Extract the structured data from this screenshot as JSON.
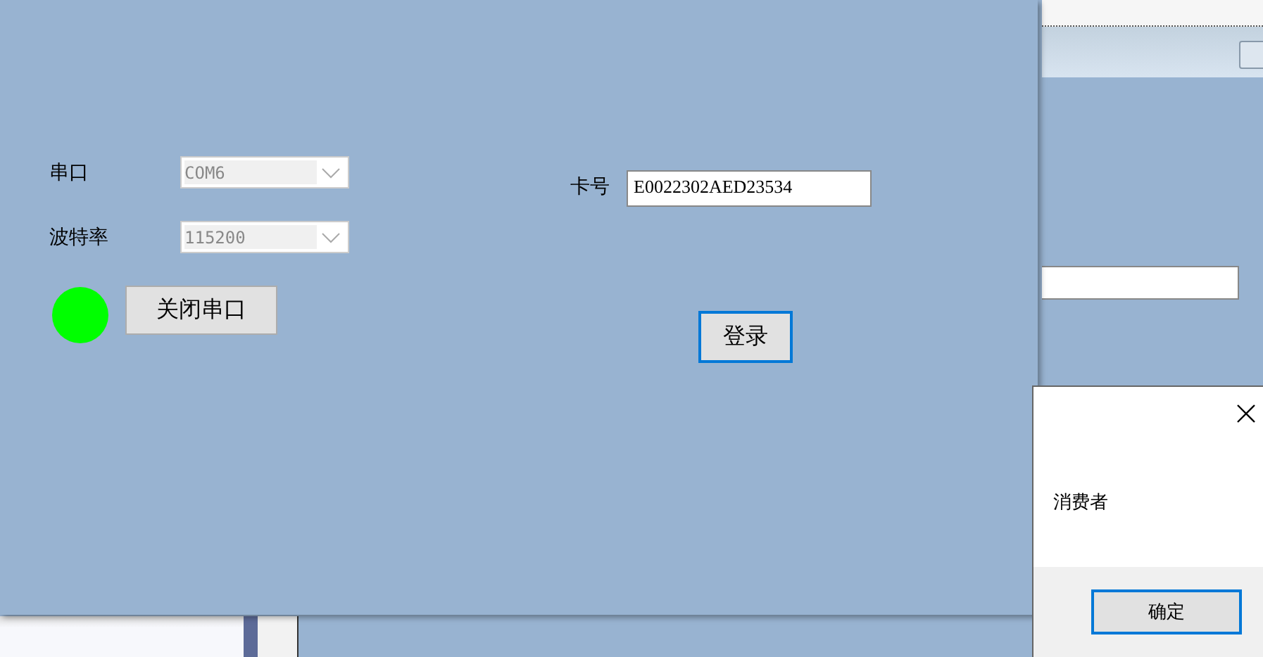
{
  "main_window": {
    "serial_settings": [
      {
        "label": "串口",
        "value": "COM6",
        "disabled": true
      },
      {
        "label": "波特率",
        "value": "115200",
        "disabled": true
      }
    ],
    "port_open": true,
    "toggle_button": "关闭串口",
    "card": {
      "label": "卡号",
      "value": "E0022302AED23534"
    },
    "login_button": "登录"
  },
  "message_box": {
    "message": "消费者",
    "ok_button": "确定"
  }
}
